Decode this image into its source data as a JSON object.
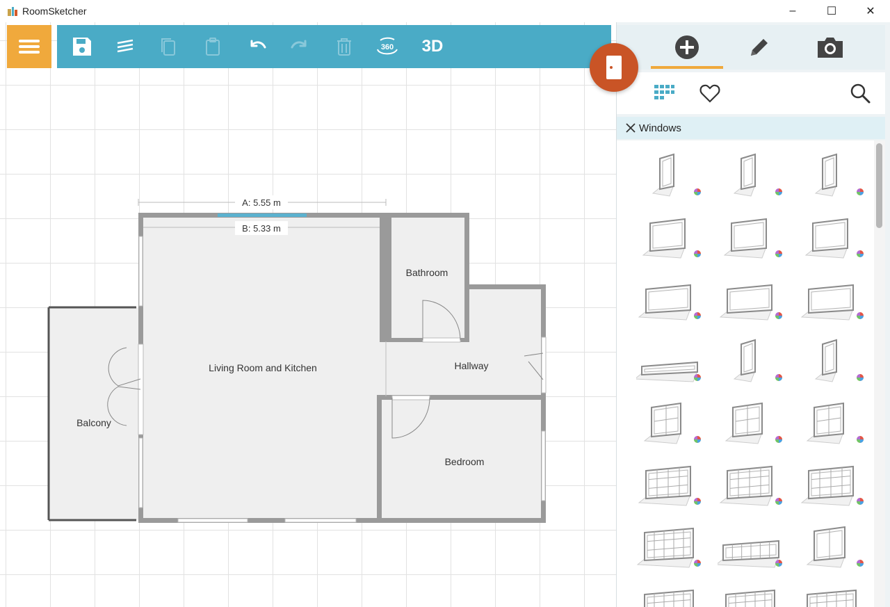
{
  "window": {
    "title": "RoomSketcher",
    "controls": {
      "minimize": "–",
      "maximize": "☐",
      "close": "✕"
    }
  },
  "toolbar": {
    "buttons": [
      {
        "name": "save",
        "enabled": true
      },
      {
        "name": "layers",
        "enabled": true
      },
      {
        "name": "copy",
        "enabled": false
      },
      {
        "name": "paste",
        "enabled": false
      },
      {
        "name": "undo",
        "enabled": true
      },
      {
        "name": "redo",
        "enabled": false
      },
      {
        "name": "delete",
        "enabled": false
      },
      {
        "name": "view-360",
        "enabled": true,
        "label": "360"
      },
      {
        "name": "view-3d",
        "enabled": true,
        "label": "3D"
      }
    ]
  },
  "panel": {
    "tabs": [
      {
        "name": "add",
        "active": true
      },
      {
        "name": "edit",
        "active": false
      },
      {
        "name": "snapshot",
        "active": false
      }
    ],
    "filter": {
      "label": "Windows"
    },
    "catalog_count": 24
  },
  "floorplan": {
    "dimension_a": "A: 5.55 m",
    "dimension_b": "B: 5.33 m",
    "rooms": [
      "Living Room and Kitchen",
      "Bathroom",
      "Hallway",
      "Bedroom",
      "Balcony"
    ]
  },
  "colors": {
    "toolbar": "#4aabc6",
    "menu": "#f0a93c",
    "door_fab": "#c95426",
    "accent_underline": "#f0a93c",
    "wall": "#9a9a9a",
    "floor": "#eeeeee"
  }
}
